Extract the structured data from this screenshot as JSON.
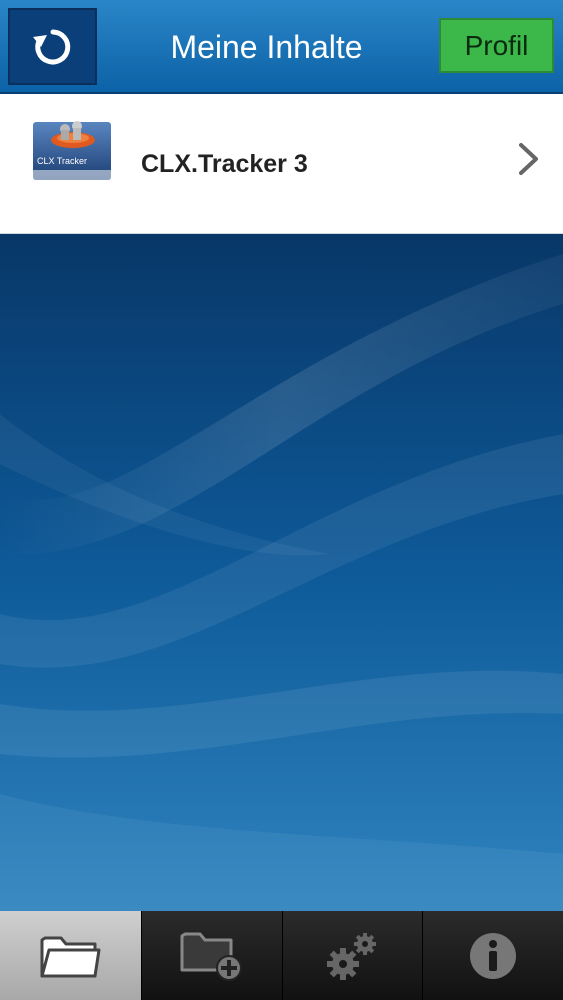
{
  "header": {
    "title": "Meine Inhalte",
    "refresh_icon": "refresh-icon",
    "profile_label": "Profil"
  },
  "content_list": [
    {
      "label": "CLX.Tracker 3",
      "thumbnail_text": "CLX Tracker",
      "icon": "chevron-right-icon"
    }
  ],
  "tabs": [
    {
      "name": "my-content",
      "icon": "folder-icon",
      "active": true
    },
    {
      "name": "add-content",
      "icon": "folder-add-icon",
      "active": false
    },
    {
      "name": "settings",
      "icon": "gears-icon",
      "active": false
    },
    {
      "name": "info",
      "icon": "info-icon",
      "active": false
    }
  ],
  "colors": {
    "header": "#1f78bf",
    "profile_button": "#3cb84a",
    "background": "#0b4a8a"
  }
}
